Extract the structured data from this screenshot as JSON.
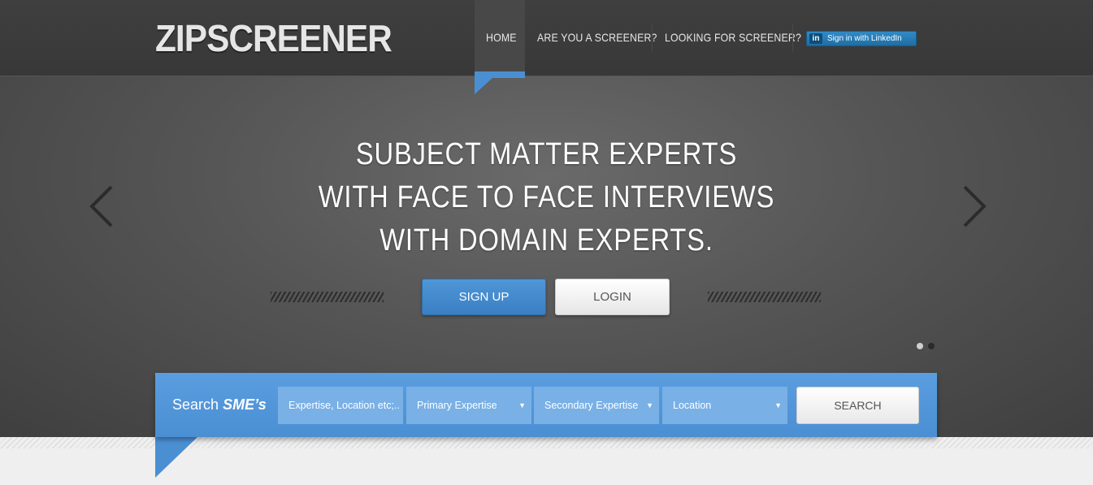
{
  "brand": {
    "logo": "ZIPSCREENER"
  },
  "nav": {
    "items": [
      {
        "label": "HOME",
        "active": true
      },
      {
        "label": "ARE YOU A SCREENER?"
      },
      {
        "label": "LOOKING FOR SCREENER?"
      }
    ],
    "linkedin": {
      "icon_text": "in",
      "label": "Sign in with LinkedIn"
    }
  },
  "hero": {
    "headline": [
      "SUBJECT MATTER EXPERTS",
      "WITH FACE TO FACE INTERVIEWS",
      "WITH DOMAIN EXPERTS."
    ],
    "signup_label": "SIGN UP",
    "login_label": "LOGIN",
    "prev_icon": "chevron-left-icon",
    "next_icon": "chevron-right-icon",
    "slide_indicator": {
      "total": 2,
      "active": 1
    }
  },
  "search": {
    "label_prefix": "Search",
    "label_emphasis": "SME’s",
    "keyword_placeholder": "Expertise, Location etc;..",
    "selects": [
      {
        "label": "Primary Expertise"
      },
      {
        "label": "Secondary Expertise"
      },
      {
        "label": "Location"
      }
    ],
    "caret": "▼",
    "button_label": "SEARCH"
  },
  "colors": {
    "accent_blue": "#4b8fd3",
    "linkedin_blue": "#2f8bc7",
    "dark_bg": "#3f3f3f"
  }
}
